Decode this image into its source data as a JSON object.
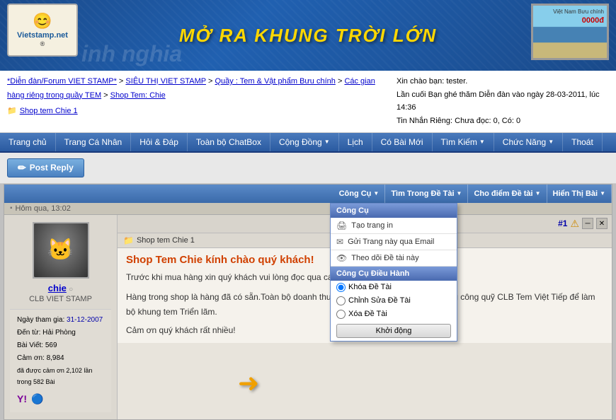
{
  "header": {
    "title": "MỞ RA KHUNG TRỜI LỚN",
    "logo_text": "Vietstamp.net",
    "registered_symbol": "®",
    "left_text": "inh nghia",
    "stamp_text": "Việt Nam\nBưu chính",
    "stamp_bridge": "🌉",
    "stamp_value": "0000đ"
  },
  "breadcrumb": {
    "items": [
      "*Diễn đàn/Forum VIET STAMP*",
      "SIÊU THỊ VIET STAMP",
      "Quầy : Tem & Vật phẩm Bưu chính",
      "Các gian hàng riêng trong quầy TEM",
      "Shop Tem: Chie"
    ],
    "current": "Shop tem Chie 1"
  },
  "user_greeting": "Xin chào bạn: tester.",
  "last_visit": "Lần cuối Bạn ghé thăm Diễn đàn vào ngày 28-03-2011, lúc 14:36",
  "inbox": "Tin Nhắn Riêng: Chưa đọc: 0, Có: 0",
  "navbar": {
    "items": [
      {
        "label": "Trang chủ",
        "has_arrow": false
      },
      {
        "label": "Trang Cá Nhân",
        "has_arrow": false
      },
      {
        "label": "Hỏi & Đáp",
        "has_arrow": false
      },
      {
        "label": "Toàn bộ ChatBox",
        "has_arrow": false
      },
      {
        "label": "Cộng Đồng",
        "has_arrow": true
      },
      {
        "label": "Lịch",
        "has_arrow": false
      },
      {
        "label": "Có Bài Mới",
        "has_arrow": false
      },
      {
        "label": "Tìm Kiếm",
        "has_arrow": true
      },
      {
        "label": "Chức Năng",
        "has_arrow": true
      },
      {
        "label": "Thoát",
        "has_arrow": false
      }
    ]
  },
  "post_reply_btn": "Post Reply",
  "thread_headers": [
    {
      "label": "Công Cụ",
      "has_arrow": true
    },
    {
      "label": "Tìm Trong Đề Tài",
      "has_arrow": true
    },
    {
      "label": "Cho điểm Đề tài",
      "has_arrow": true
    },
    {
      "label": "Hiển Thị Bài",
      "has_arrow": true
    }
  ],
  "post_meta": {
    "time": "Hôm qua, 13:02",
    "icon": "▪"
  },
  "post_number": "#1",
  "user": {
    "name": "chie",
    "online_status": "○",
    "group": "CLB VIET STAMP",
    "join_date": "31-12-2007",
    "from": "Hải Phòng",
    "posts": "569",
    "reactions": "8,984",
    "thanks_received": "2,102 lần trong 582 Bài"
  },
  "user_stats_labels": {
    "join": "Ngày tham gia:",
    "from": "Đến từ:",
    "posts": "Bài Viết:",
    "cam_on": "Cảm ơn:",
    "da_duoc": "đã được cảm ơn"
  },
  "dropdown": {
    "tools_title": "Công Cụ",
    "items": [
      {
        "icon": "🔧",
        "label": "Tạo trang in"
      },
      {
        "icon": "✉",
        "label": "Gửi Trang này qua Email"
      },
      {
        "icon": "👁",
        "label": "Theo dõi Đề tài này"
      }
    ],
    "admin_title": "Công Cụ Điều Hành",
    "admin_options": [
      {
        "label": "Khóa Đề Tài",
        "selected": true
      },
      {
        "label": "Chỉnh Sửa Đề Tài",
        "selected": false
      },
      {
        "label": "Xóa Đề Tài",
        "selected": false
      }
    ],
    "submit_btn": "Khởi động"
  },
  "post": {
    "shop_title": "Shop tem Chie 1",
    "title": "Shop Tem Chie kính chào quý khách!",
    "body_line1": "Trước khi mua hàng xin quý khách vui lòng đọc qua các thông tin sau đây:",
    "body_line2": "",
    "body_line3": "Hàng trong shop là hàng đã có sẵn.Toàn bộ doanh thu của các shop Chie sẽ được xung công quỹ CLB Tem Việt Tiếp để làm bộ khung tem Triển lãm.",
    "body_line4": "Cảm ơn quý khách rất nhiều!"
  },
  "theo_label": "Theo",
  "icons": {
    "folder": "📁",
    "warning": "⚠",
    "close": "✕",
    "minimize": "─",
    "online": "●",
    "arrow_right": "→"
  }
}
